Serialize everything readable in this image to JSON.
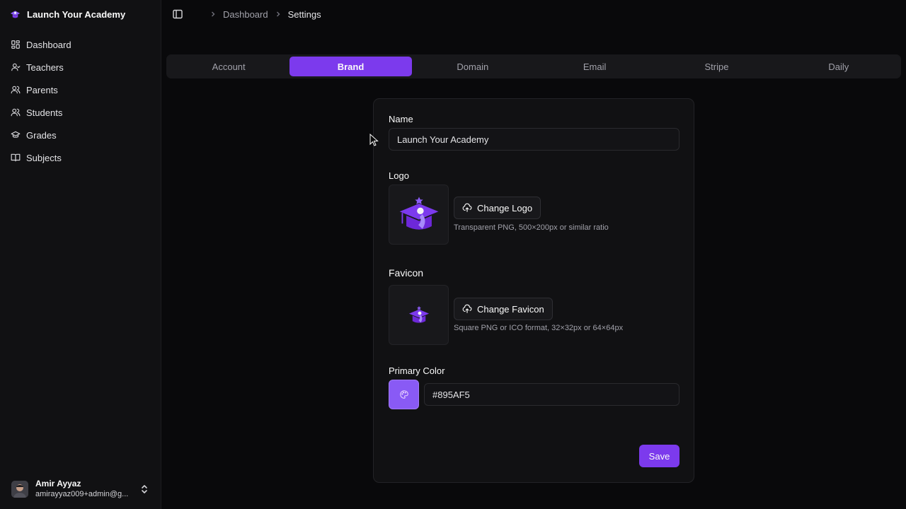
{
  "app": {
    "name": "Launch Your Academy"
  },
  "sidebar": {
    "items": [
      {
        "label": "Dashboard",
        "icon": "grid-icon"
      },
      {
        "label": "Teachers",
        "icon": "user-icon"
      },
      {
        "label": "Parents",
        "icon": "users-icon"
      },
      {
        "label": "Students",
        "icon": "users-icon"
      },
      {
        "label": "Grades",
        "icon": "graduation-cap-icon"
      },
      {
        "label": "Subjects",
        "icon": "book-open-icon"
      }
    ],
    "user": {
      "name": "Amir Ayyaz",
      "email": "amirayyaz009+admin@g..."
    }
  },
  "breadcrumb": {
    "parent": "Dashboard",
    "current": "Settings"
  },
  "tabs": [
    {
      "label": "Account",
      "active": false
    },
    {
      "label": "Brand",
      "active": true
    },
    {
      "label": "Domain",
      "active": false
    },
    {
      "label": "Email",
      "active": false
    },
    {
      "label": "Stripe",
      "active": false
    },
    {
      "label": "Daily",
      "active": false
    }
  ],
  "form": {
    "name_label": "Name",
    "name_value": "Launch Your Academy",
    "logo_label": "Logo",
    "change_logo": "Change Logo",
    "logo_hint": "Transparent PNG, 500×200px or similar ratio",
    "favicon_label": "Favicon",
    "change_favicon": "Change Favicon",
    "favicon_hint": "Square PNG or ICO format, 32×32px or 64×64px",
    "color_label": "Primary Color",
    "color_value": "#895AF5",
    "save_label": "Save"
  },
  "colors": {
    "accent": "#7c3aed",
    "primary": "#895AF5",
    "background": "#09090b",
    "sidebar": "#111113"
  }
}
